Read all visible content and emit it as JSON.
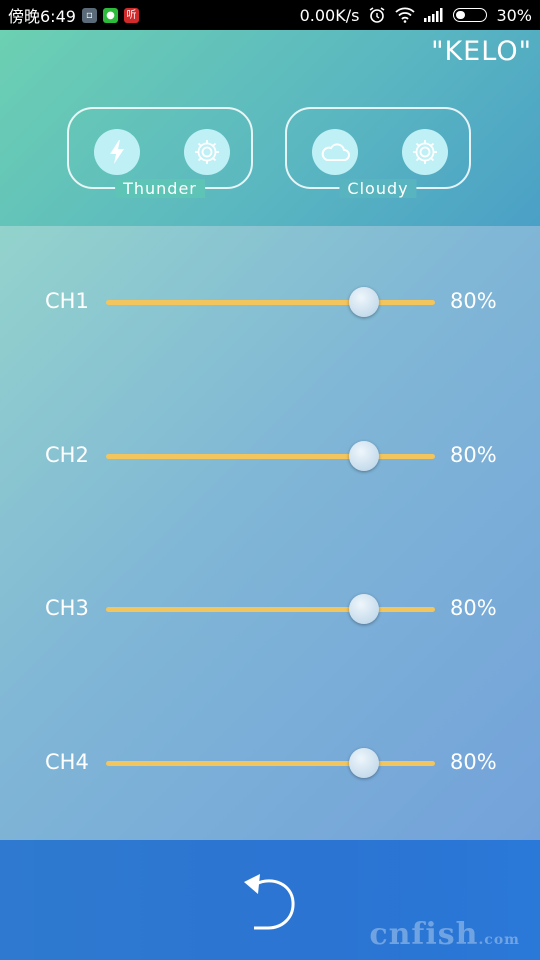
{
  "status_bar": {
    "time": "傍晚6:49",
    "net_speed": "0.00K/s",
    "battery": "30%",
    "app_icons": [
      "message-icon",
      "wechat-icon",
      "listen-app-icon"
    ],
    "listen_app_glyph": "听"
  },
  "header": {
    "title": "\"KELO\"",
    "modes": [
      {
        "label": "Thunder",
        "icon": "lightning-icon",
        "settings_icon": "gear-icon"
      },
      {
        "label": "Cloudy",
        "icon": "cloud-icon",
        "settings_icon": "gear-icon"
      }
    ]
  },
  "channels": [
    {
      "label": "CH1",
      "value": 80,
      "display": "80%"
    },
    {
      "label": "CH2",
      "value": 80,
      "display": "80%"
    },
    {
      "label": "CH3",
      "value": 80,
      "display": "80%"
    },
    {
      "label": "CH4",
      "value": 80,
      "display": "80%"
    }
  ],
  "footer": {
    "back_icon": "undo-icon",
    "watermark": "cnfish",
    "watermark_suffix": ".com"
  },
  "colors": {
    "header_start": "#6cd0b2",
    "header_end": "#4aa0c6",
    "slider_track": "#f2c55e",
    "footer": "#2f7ad0"
  }
}
